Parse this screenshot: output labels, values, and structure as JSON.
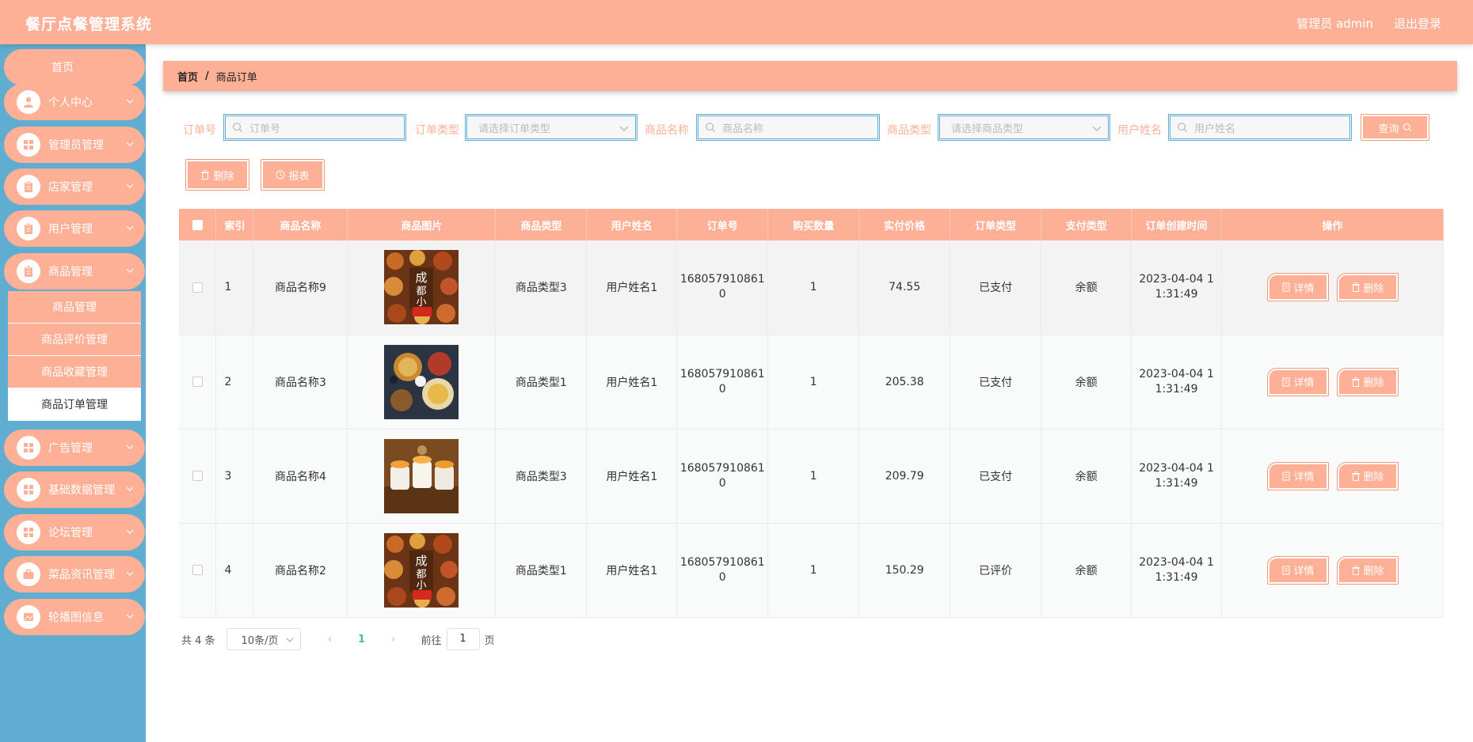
{
  "header": {
    "app_title": "餐厅点餐管理系统",
    "user_label": "管理员 admin",
    "logout_label": "退出登录"
  },
  "sidebar": {
    "home_label": "首页",
    "items": [
      {
        "label": "个人中心",
        "icon": "user-icon"
      },
      {
        "label": "管理员管理",
        "icon": "grid-icon"
      },
      {
        "label": "店家管理",
        "icon": "clipboard-icon"
      },
      {
        "label": "用户管理",
        "icon": "clipboard-icon"
      },
      {
        "label": "商品管理",
        "icon": "clipboard-icon"
      },
      {
        "label": "广告管理",
        "icon": "grid-icon"
      },
      {
        "label": "基础数据管理",
        "icon": "grid-icon"
      },
      {
        "label": "论坛管理",
        "icon": "grid-icon"
      },
      {
        "label": "菜品资讯管理",
        "icon": "briefcase-icon"
      },
      {
        "label": "轮播图信息",
        "icon": "image-icon"
      }
    ],
    "submenu": [
      {
        "label": "商品管理",
        "active": false
      },
      {
        "label": "商品评价管理",
        "active": false
      },
      {
        "label": "商品收藏管理",
        "active": false
      },
      {
        "label": "商品订单管理",
        "active": true
      }
    ]
  },
  "breadcrumb": {
    "home": "首页",
    "separator": "/",
    "current": "商品订单"
  },
  "search": {
    "order_no_label": "订单号",
    "order_no_placeholder": "订单号",
    "order_type_label": "订单类型",
    "order_type_placeholder": "请选择订单类型",
    "product_name_label": "商品名称",
    "product_name_placeholder": "商品名称",
    "product_type_label": "商品类型",
    "product_type_placeholder": "请选择商品类型",
    "user_name_label": "用户姓名",
    "user_name_placeholder": "用户姓名",
    "query_button": "查询"
  },
  "toolbar": {
    "delete_label": "删除",
    "report_label": "报表"
  },
  "table": {
    "columns": [
      "索引",
      "商品名称",
      "商品图片",
      "商品类型",
      "用户姓名",
      "订单号",
      "购买数量",
      "实付价格",
      "订单类型",
      "支付类型",
      "订单创建时间",
      "操作"
    ],
    "detail_label": "详情",
    "delete_label": "删除",
    "rows": [
      {
        "index": "1",
        "name": "商品名称9",
        "image": "food-photo-skewers",
        "type": "商品类型3",
        "user": "用户姓名1",
        "order_no_1": "168057910861",
        "order_no_2": "0",
        "qty": "1",
        "price": "74.55",
        "order_type": "已支付",
        "pay_type": "余额",
        "time_1": "2023-04-04 1",
        "time_2": "1:31:49"
      },
      {
        "index": "2",
        "name": "商品名称3",
        "image": "food-photo-platter",
        "type": "商品类型1",
        "user": "用户姓名1",
        "order_no_1": "168057910861",
        "order_no_2": "0",
        "qty": "1",
        "price": "205.38",
        "order_type": "已支付",
        "pay_type": "余额",
        "time_1": "2023-04-04 1",
        "time_2": "1:31:49"
      },
      {
        "index": "3",
        "name": "商品名称4",
        "image": "food-photo-sushi",
        "type": "商品类型3",
        "user": "用户姓名1",
        "order_no_1": "168057910861",
        "order_no_2": "0",
        "qty": "1",
        "price": "209.79",
        "order_type": "已支付",
        "pay_type": "余额",
        "time_1": "2023-04-04 1",
        "time_2": "1:31:49"
      },
      {
        "index": "4",
        "name": "商品名称2",
        "image": "food-photo-skewers",
        "type": "商品类型1",
        "user": "用户姓名1",
        "order_no_1": "168057910861",
        "order_no_2": "0",
        "qty": "1",
        "price": "150.29",
        "order_type": "已评价",
        "pay_type": "余额",
        "time_1": "2023-04-04 1",
        "time_2": "1:31:49"
      }
    ]
  },
  "pagination": {
    "total_text": "共 4 条",
    "page_size": "10条/页",
    "prev": "‹",
    "current_page": "1",
    "next": "›",
    "goto_label": "前往",
    "goto_value": "1",
    "page_suffix": "页"
  },
  "colors": {
    "primary": "#fdb095",
    "sidebar": "#5fadd1",
    "active_page": "#4bbf9a"
  }
}
